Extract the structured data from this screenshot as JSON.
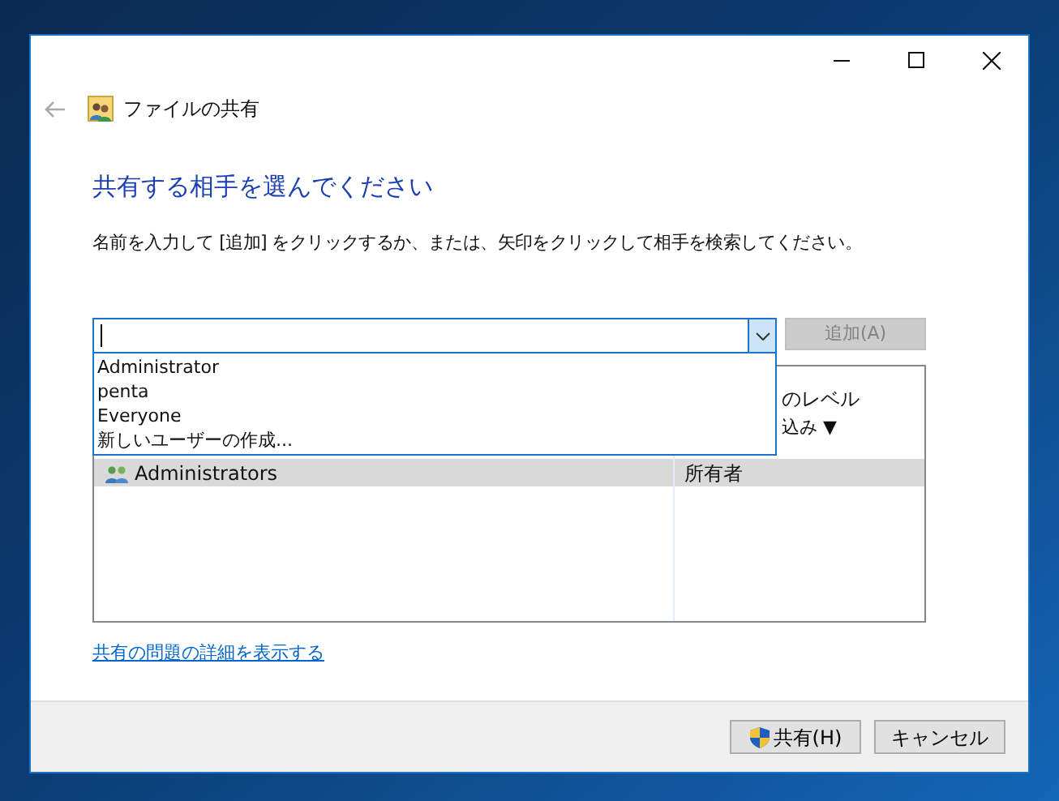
{
  "window": {
    "title": "ファイルの共有"
  },
  "heading": "共有する相手を選んでください",
  "instruction": "名前を入力して [追加] をクリックするか、または、矢印をクリックして相手を検索してください。",
  "name_combo": {
    "expanded": true,
    "options": [
      {
        "label": "Administrator"
      },
      {
        "label": "penta"
      },
      {
        "label": "Everyone"
      },
      {
        "label": "新しいユーザーの作成..."
      }
    ]
  },
  "add_button": {
    "label": "追加(A)",
    "disabled": true
  },
  "share_list": {
    "column_2_header": "のレベル",
    "level_menu": "込み ▼",
    "rows": [
      {
        "name": "Administrators",
        "level": "所有者",
        "selected": true
      }
    ]
  },
  "details_link": "共有の問題の詳細を表示する",
  "buttons": [
    {
      "label": "共有(H)",
      "kind": "shield"
    },
    {
      "label": "キャンセル",
      "kind": "plain"
    }
  ]
}
